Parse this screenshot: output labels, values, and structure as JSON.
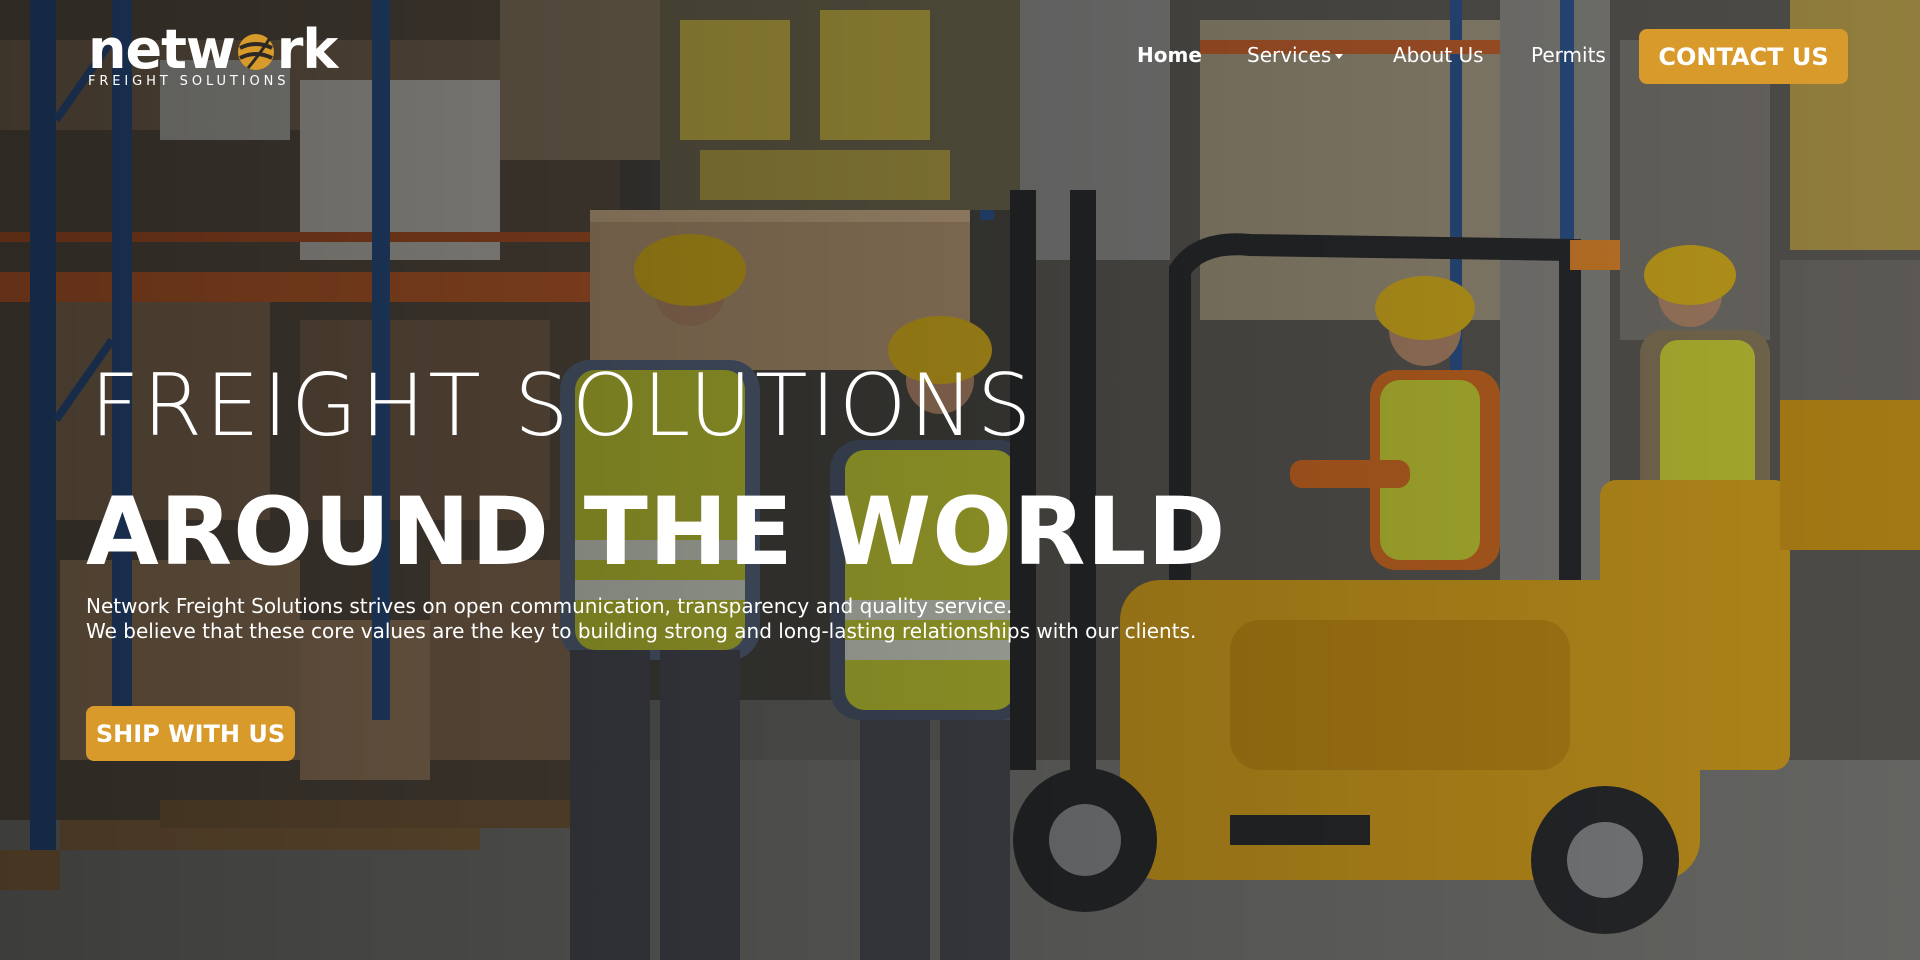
{
  "brand": {
    "logo_word_left": "netw",
    "logo_word_right": "rk",
    "logo_tagline": "FREIGHT SOLUTIONS",
    "accent_color": "#d79a2b"
  },
  "nav": {
    "items": [
      {
        "label": "Home",
        "active": true
      },
      {
        "label": "Services",
        "has_dropdown": true,
        "icon": "caret-down-icon"
      },
      {
        "label": "About Us"
      },
      {
        "label": "Permits"
      }
    ],
    "cta_label": "CONTACT US"
  },
  "hero": {
    "headline_line1": "FREIGHT SOLUTIONS",
    "headline_line2": "AROUND THE WORLD",
    "body_line1": "Network Freight Solutions strives on open communication, transparency and quality service.",
    "body_line2": "We believe that these core values are the key to building strong and long-lasting relationships with our clients.",
    "cta_label": "SHIP WITH US",
    "background": "warehouse-photo-forklift-workers"
  }
}
